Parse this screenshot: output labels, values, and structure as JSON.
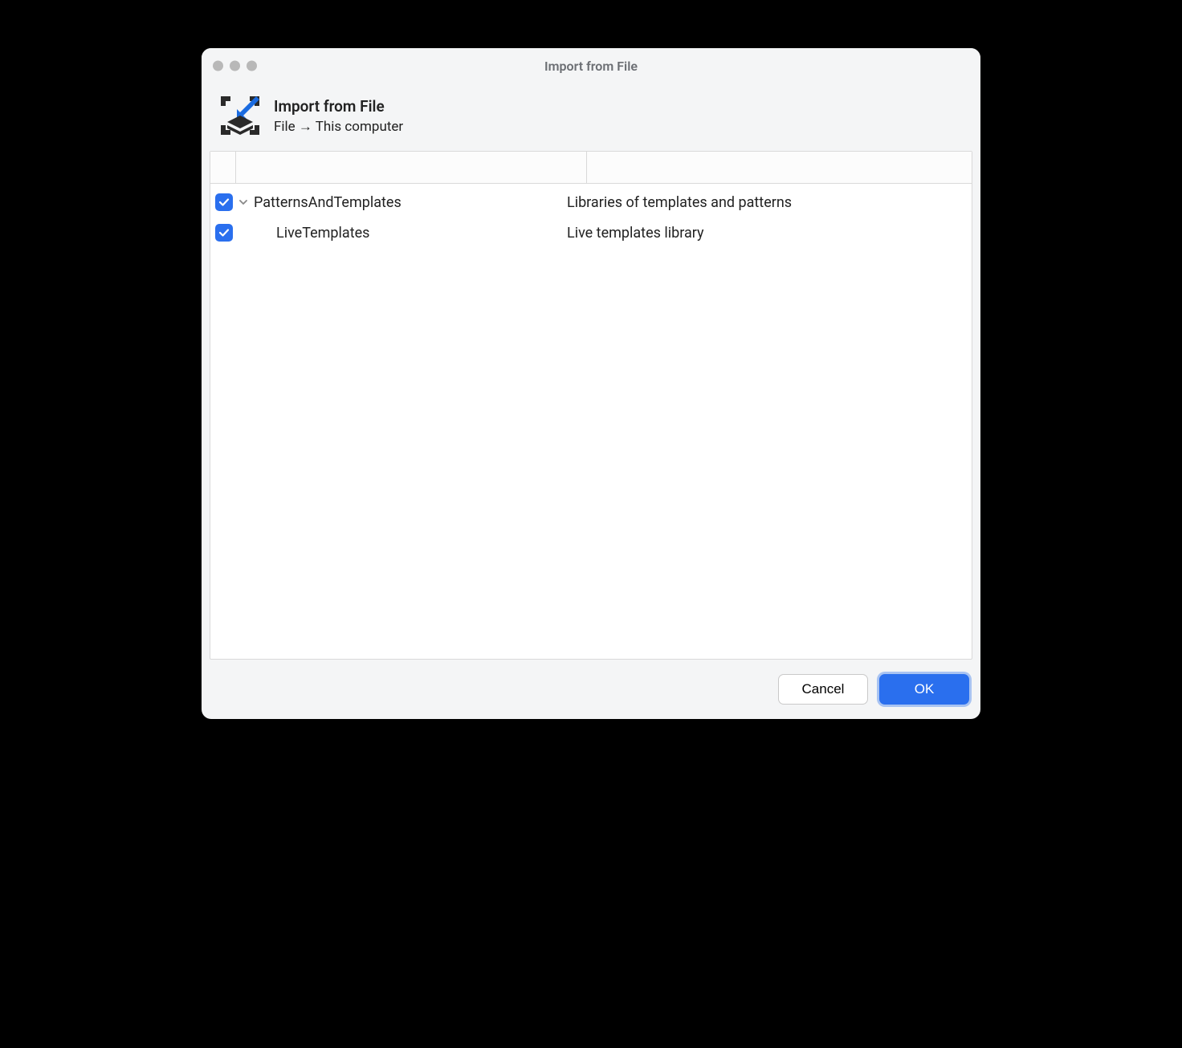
{
  "window": {
    "title": "Import from File"
  },
  "header": {
    "title": "Import from File",
    "subtitle": "File → This computer"
  },
  "tree": {
    "items": [
      {
        "checked": true,
        "expandable": true,
        "expanded": true,
        "level": 0,
        "name": "PatternsAndTemplates",
        "description": "Libraries of templates and patterns"
      },
      {
        "checked": true,
        "expandable": false,
        "expanded": false,
        "level": 1,
        "name": "LiveTemplates",
        "description": "Live templates library"
      }
    ]
  },
  "buttons": {
    "cancel": "Cancel",
    "ok": "OK"
  }
}
